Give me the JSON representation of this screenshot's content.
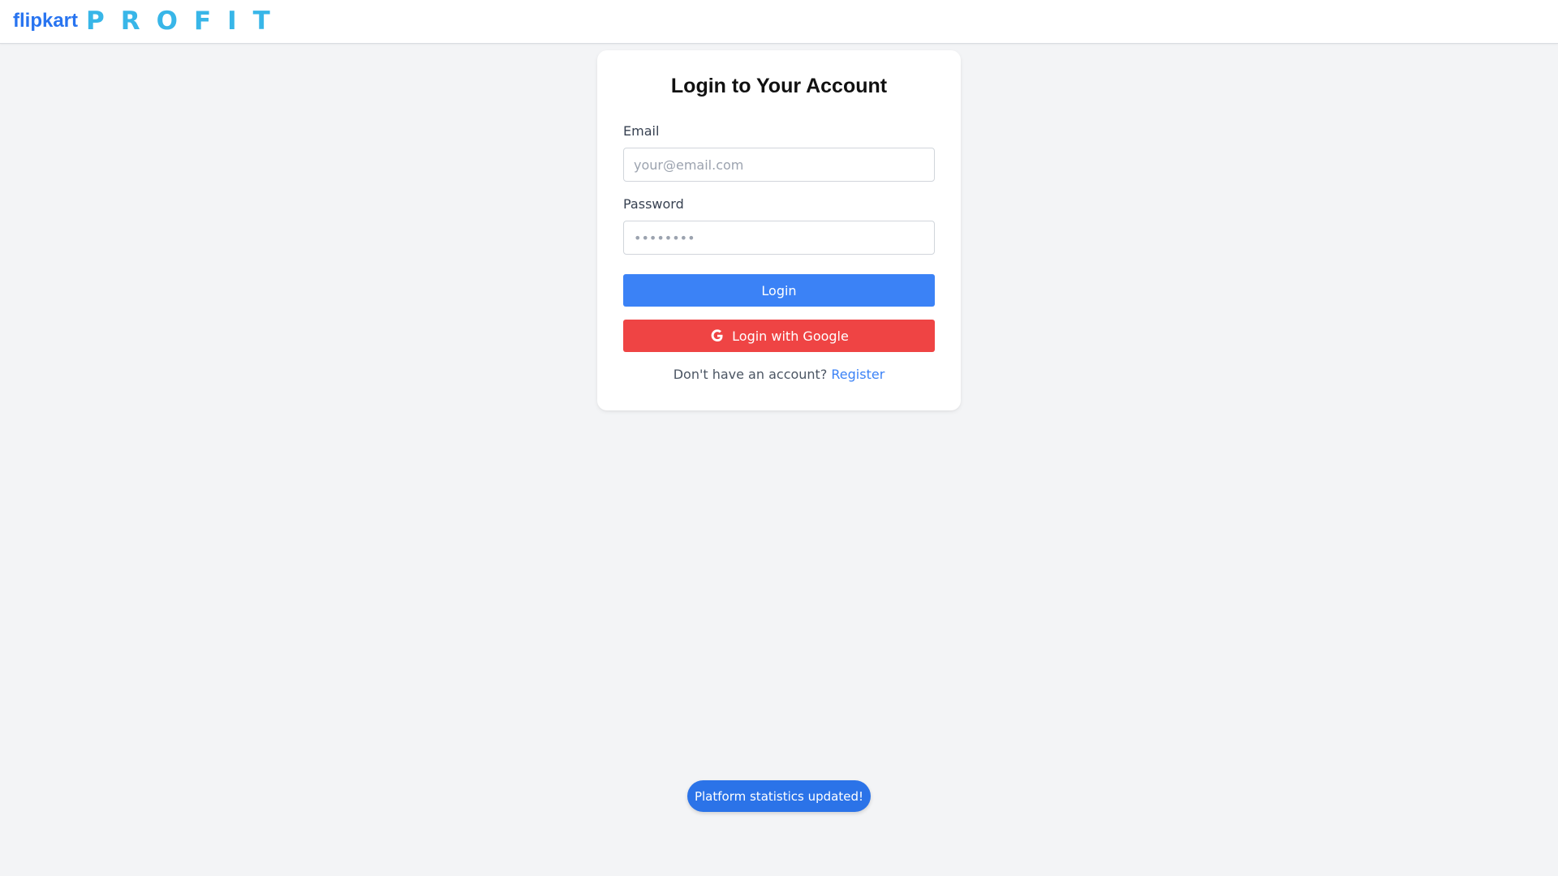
{
  "header": {
    "brand": "flipkart",
    "product": "PROFIT"
  },
  "login": {
    "title": "Login to Your Account",
    "email_label": "Email",
    "email_placeholder": "your@email.com",
    "email_value": "",
    "password_label": "Password",
    "password_placeholder": "••••••••",
    "password_value": "",
    "login_button": "Login",
    "google_button": "Login with Google",
    "register_prompt": "Don't have an account?",
    "register_link": "Register"
  },
  "toast": {
    "message": "Platform statistics updated!"
  },
  "icons": {
    "google": "google-icon"
  },
  "colors": {
    "brand_blue": "#2874f0",
    "profit_blue": "#38b6e8",
    "primary_button": "#3b82f6",
    "google_button": "#ef4444",
    "toast_bg": "#2b73e8",
    "page_bg": "#f3f4f6"
  }
}
